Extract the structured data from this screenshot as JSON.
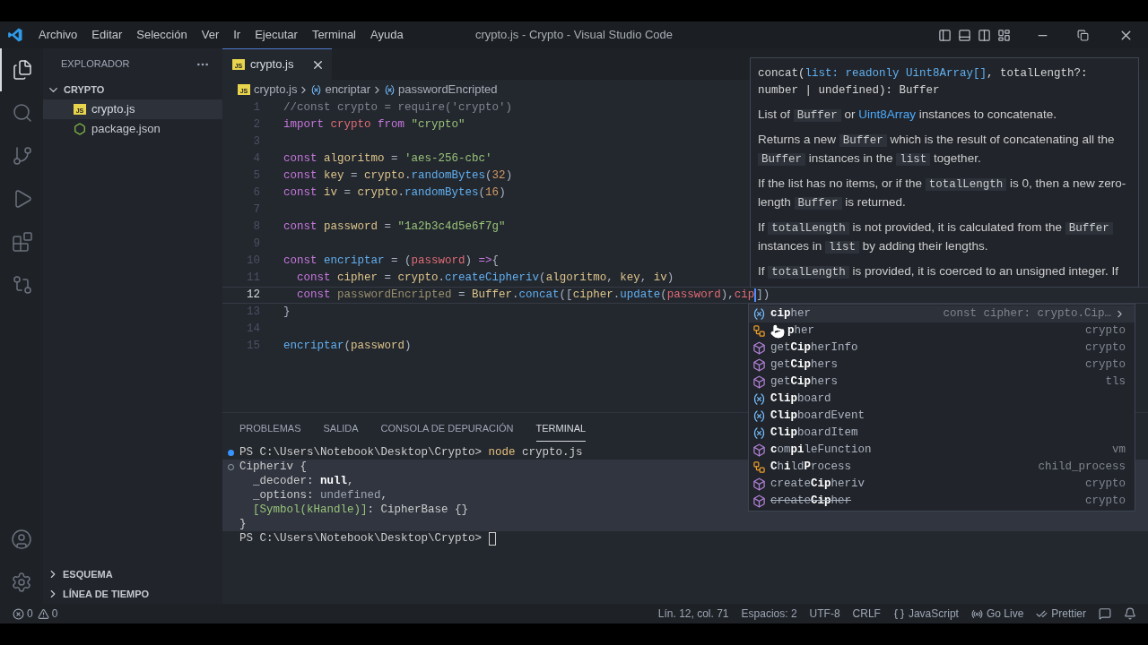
{
  "title_bar": {
    "menu": [
      "Archivo",
      "Editar",
      "Selección",
      "Ver",
      "Ir",
      "Ejecutar",
      "Terminal",
      "Ayuda"
    ],
    "title": "crypto.js - Crypto - Visual Studio Code"
  },
  "activity_bar": {
    "top": [
      {
        "kind": "files",
        "selected": true
      },
      {
        "kind": "search",
        "selected": false
      },
      {
        "kind": "source_control",
        "selected": false
      },
      {
        "kind": "run",
        "selected": false
      },
      {
        "kind": "extensions",
        "selected": false
      },
      {
        "kind": "remote",
        "selected": false
      }
    ],
    "bottom": [
      {
        "kind": "account"
      },
      {
        "kind": "settings"
      }
    ]
  },
  "sidebar": {
    "title": "EXPLORADOR",
    "folder": {
      "name": "CRYPTO",
      "expanded": true,
      "files": [
        {
          "name": "crypto.js",
          "kind": "js",
          "icon_text": "JS",
          "selected": true
        },
        {
          "name": "package.json",
          "kind": "json",
          "selected": false
        }
      ]
    },
    "sections": [
      {
        "name": "ESQUEMA",
        "expanded": false
      },
      {
        "name": "LÍNEA DE TIEMPO",
        "expanded": false
      }
    ]
  },
  "editor": {
    "tab": {
      "name": "crypto.js",
      "icon_text": "JS"
    },
    "breadcrumb": [
      {
        "text": "crypto.js",
        "kind": "file",
        "icon_text": "JS"
      },
      {
        "text": "encriptar",
        "kind": "symbol"
      },
      {
        "text": "passwordEncripted",
        "kind": "symbol"
      }
    ],
    "lines": [
      {
        "number": "1",
        "current": false,
        "tokens": [
          {
            "text": "//const crypto = require('crypto')",
            "kind": "comment"
          }
        ]
      },
      {
        "number": "2",
        "current": false,
        "tokens": [
          {
            "text": "import",
            "kind": "keyword"
          },
          {
            "text": " crypto",
            "kind": "module"
          },
          {
            "text": " from",
            "kind": "keyword"
          },
          {
            "text": " \"crypto\"",
            "kind": "string"
          }
        ]
      },
      {
        "number": "3",
        "current": false
      },
      {
        "number": "4",
        "current": false,
        "tokens": [
          {
            "text": "const",
            "kind": "keyword"
          },
          {
            "text": " algoritmo",
            "kind": "variable"
          },
          {
            "text": " = ",
            "kind": "plain"
          },
          {
            "text": "'aes-256-cbc'",
            "kind": "string"
          }
        ]
      },
      {
        "number": "5",
        "current": false,
        "tokens": [
          {
            "text": "const",
            "kind": "keyword"
          },
          {
            "text": " key",
            "kind": "variable"
          },
          {
            "text": " = ",
            "kind": "plain"
          },
          {
            "text": "crypto",
            "kind": "variable"
          },
          {
            "text": ".",
            "kind": "plain"
          },
          {
            "text": "randomBytes",
            "kind": "function"
          },
          {
            "text": "(",
            "kind": "plain"
          },
          {
            "text": "32",
            "kind": "number"
          },
          {
            "text": ")",
            "kind": "plain"
          }
        ]
      },
      {
        "number": "6",
        "current": false,
        "tokens": [
          {
            "text": "const",
            "kind": "keyword"
          },
          {
            "text": " iv",
            "kind": "variable"
          },
          {
            "text": " = ",
            "kind": "plain"
          },
          {
            "text": "crypto",
            "kind": "variable"
          },
          {
            "text": ".",
            "kind": "plain"
          },
          {
            "text": "randomBytes",
            "kind": "function"
          },
          {
            "text": "(",
            "kind": "plain"
          },
          {
            "text": "16",
            "kind": "number"
          },
          {
            "text": ")",
            "kind": "plain"
          }
        ]
      },
      {
        "number": "7",
        "current": false
      },
      {
        "number": "8",
        "current": false,
        "tokens": [
          {
            "text": "const",
            "kind": "keyword"
          },
          {
            "text": " password",
            "kind": "variable"
          },
          {
            "text": " = ",
            "kind": "plain"
          },
          {
            "text": "\"1a2b3c4d5e6f7g\"",
            "kind": "string"
          }
        ]
      },
      {
        "number": "9",
        "current": false
      },
      {
        "number": "10",
        "current": false,
        "tokens": [
          {
            "text": "const",
            "kind": "keyword"
          },
          {
            "text": " encriptar",
            "kind": "function"
          },
          {
            "text": " = (",
            "kind": "plain"
          },
          {
            "text": "password",
            "kind": "param"
          },
          {
            "text": ") ",
            "kind": "plain"
          },
          {
            "text": "=>",
            "kind": "keyword"
          },
          {
            "text": "{",
            "kind": "plain"
          }
        ]
      },
      {
        "number": "11",
        "current": false,
        "tokens": [
          {
            "text": "  const",
            "kind": "keyword"
          },
          {
            "text": " cipher",
            "kind": "variable"
          },
          {
            "text": " = ",
            "kind": "plain"
          },
          {
            "text": "crypto",
            "kind": "variable"
          },
          {
            "text": ".",
            "kind": "plain"
          },
          {
            "text": "createCipheriv",
            "kind": "function"
          },
          {
            "text": "(",
            "kind": "plain"
          },
          {
            "text": "algoritmo",
            "kind": "variable"
          },
          {
            "text": ", ",
            "kind": "plain"
          },
          {
            "text": "key",
            "kind": "variable"
          },
          {
            "text": ", ",
            "kind": "plain"
          },
          {
            "text": "iv",
            "kind": "variable"
          },
          {
            "text": ")",
            "kind": "plain"
          }
        ]
      },
      {
        "number": "12",
        "current": true,
        "tokens": [
          {
            "text": "  const",
            "kind": "keyword"
          },
          {
            "text": " passwordEncripted",
            "kind": "unused"
          },
          {
            "text": " = ",
            "kind": "plain"
          },
          {
            "text": "Buffer",
            "kind": "variable"
          },
          {
            "text": ".",
            "kind": "plain"
          },
          {
            "text": "concat",
            "kind": "function"
          },
          {
            "text": "([",
            "kind": "plain"
          },
          {
            "text": "cipher",
            "kind": "variable"
          },
          {
            "text": ".",
            "kind": "plain"
          },
          {
            "text": "update",
            "kind": "function"
          },
          {
            "text": "(",
            "kind": "plain"
          },
          {
            "text": "password",
            "kind": "param"
          },
          {
            "text": "),",
            "kind": "plain"
          },
          {
            "text": "cip",
            "kind": "param",
            "caret": true
          },
          {
            "text": "])",
            "kind": "plain"
          }
        ]
      },
      {
        "number": "13",
        "current": false,
        "tokens": [
          {
            "text": "}",
            "kind": "plain"
          }
        ]
      },
      {
        "number": "14",
        "current": false
      },
      {
        "number": "15",
        "current": false,
        "tokens": [
          {
            "text": "encriptar",
            "kind": "function"
          },
          {
            "text": "(",
            "kind": "plain"
          },
          {
            "text": "password",
            "kind": "variable"
          },
          {
            "text": ")",
            "kind": "plain"
          }
        ]
      }
    ],
    "hover": {
      "signature": [
        {
          "text": "concat(",
          "kind": "plain"
        },
        {
          "text": "list: readonly Uint8Array[]",
          "kind": "type"
        },
        {
          "text": ", totalLength?: number | undefined): Buffer",
          "kind": "plain"
        }
      ],
      "paragraphs": [
        [
          {
            "text": "List of ",
            "kind": "text"
          },
          {
            "text": "Buffer",
            "kind": "code"
          },
          {
            "text": " or ",
            "kind": "text"
          },
          {
            "text": "Uint8Array",
            "kind": "link"
          },
          {
            "text": " instances to concatenate.",
            "kind": "text"
          }
        ],
        [
          {
            "text": "Returns a new ",
            "kind": "text"
          },
          {
            "text": "Buffer",
            "kind": "code"
          },
          {
            "text": " which is the result of concatenating all the ",
            "kind": "text"
          },
          {
            "text": "Buffer",
            "kind": "code"
          },
          {
            "text": " instances in the ",
            "kind": "text"
          },
          {
            "text": "list",
            "kind": "code"
          },
          {
            "text": " together.",
            "kind": "text"
          }
        ],
        [
          {
            "text": "If the list has no items, or if the ",
            "kind": "text"
          },
          {
            "text": "totalLength",
            "kind": "code"
          },
          {
            "text": " is 0, then a new zero-length ",
            "kind": "text"
          },
          {
            "text": "Buffer",
            "kind": "code"
          },
          {
            "text": " is returned.",
            "kind": "text"
          }
        ],
        [
          {
            "text": "If ",
            "kind": "text"
          },
          {
            "text": "totalLength",
            "kind": "code"
          },
          {
            "text": " is not provided, it is calculated from the ",
            "kind": "text"
          },
          {
            "text": "Buffer",
            "kind": "code"
          },
          {
            "text": " instances in ",
            "kind": "text"
          },
          {
            "text": "list",
            "kind": "code"
          },
          {
            "text": " by adding their lengths.",
            "kind": "text"
          }
        ],
        [
          {
            "text": "If ",
            "kind": "text"
          },
          {
            "text": "totalLength",
            "kind": "code"
          },
          {
            "text": " is provided, it is coerced to an unsigned integer. If",
            "kind": "text"
          }
        ]
      ]
    },
    "suggestions": [
      {
        "kind": "variable",
        "label": "**cip**her",
        "detail": "const cipher: crypto.Cip…",
        "selected": true,
        "deprecated": false
      },
      {
        "kind": "class",
        "label": "**p**her",
        "detail": "crypto",
        "selected": false,
        "deprecated": false,
        "under_pointer": true
      },
      {
        "kind": "method",
        "label": "get**Cip**herInfo",
        "detail": "crypto",
        "selected": false,
        "deprecated": false
      },
      {
        "kind": "method",
        "label": "get**Cip**hers",
        "detail": "crypto",
        "selected": false,
        "deprecated": false
      },
      {
        "kind": "method",
        "label": "get**Cip**hers",
        "detail": "tls",
        "selected": false,
        "deprecated": false
      },
      {
        "kind": "variable",
        "label": "**Clip**board",
        "selected": false,
        "deprecated": false
      },
      {
        "kind": "variable",
        "label": "**Clip**boardEvent",
        "selected": false,
        "deprecated": false
      },
      {
        "kind": "variable",
        "label": "**Clip**boardItem",
        "selected": false,
        "deprecated": false
      },
      {
        "kind": "method",
        "label": "**c**om**pi**leFunction",
        "detail": "vm",
        "selected": false,
        "deprecated": false
      },
      {
        "kind": "class",
        "label": "**C**h**i**ld**P**rocess",
        "detail": "child_process",
        "selected": false,
        "deprecated": false
      },
      {
        "kind": "method",
        "label": "create**Cip**heriv",
        "detail": "crypto",
        "selected": false,
        "deprecated": false
      },
      {
        "kind": "method",
        "label": "create**Cip**her",
        "detail": "crypto",
        "selected": false,
        "deprecated": true
      }
    ]
  },
  "panel": {
    "tabs": [
      {
        "label": "PROBLEMAS",
        "selected": false
      },
      {
        "label": "SALIDA",
        "selected": false
      },
      {
        "label": "CONSOLA DE DEPURACIÓN",
        "selected": false
      },
      {
        "label": "TERMINAL",
        "selected": true
      }
    ],
    "terminal": [
      {
        "kind": "command",
        "highlighted": false,
        "tokens": [
          {
            "text": "PS C:\\Users\\Notebook\\Desktop\\Crypto> ",
            "kind": "plain"
          },
          {
            "text": "node",
            "kind": "command"
          },
          {
            "text": " crypto.js",
            "kind": "plain"
          }
        ]
      },
      {
        "kind": "output",
        "highlighted": true,
        "tokens": [
          {
            "text": "Cipheriv {",
            "kind": "plain"
          }
        ]
      },
      {
        "highlighted": true,
        "tokens": [
          {
            "text": "  _decoder: ",
            "kind": "plain"
          },
          {
            "text": "null",
            "kind": "bold"
          },
          {
            "text": ",",
            "kind": "plain"
          }
        ]
      },
      {
        "highlighted": true,
        "tokens": [
          {
            "text": "  _options: ",
            "kind": "plain"
          },
          {
            "text": "undefined",
            "kind": "muted"
          },
          {
            "text": ",",
            "kind": "plain"
          }
        ]
      },
      {
        "highlighted": true,
        "tokens": [
          {
            "text": "  [Symbol(kHandle)]",
            "kind": "green"
          },
          {
            "text": ": CipherBase {}",
            "kind": "plain"
          }
        ]
      },
      {
        "highlighted": true,
        "tokens": [
          {
            "text": "}",
            "kind": "plain"
          }
        ]
      },
      {
        "highlighted": false,
        "prompt_cursor": true,
        "tokens": [
          {
            "text": "PS C:\\Users\\Notebook\\Desktop\\Crypto> ",
            "kind": "plain"
          }
        ]
      }
    ]
  },
  "status_bar": {
    "errors": "0",
    "warnings": "0",
    "items": [
      {
        "kind": "text",
        "text": "Lín. 12, col. 71"
      },
      {
        "kind": "text",
        "text": "Espacios: 2"
      },
      {
        "kind": "text",
        "text": "UTF-8"
      },
      {
        "kind": "text",
        "text": "CRLF"
      },
      {
        "kind": "language",
        "text": "JavaScript"
      },
      {
        "kind": "golive",
        "text": "Go Live"
      },
      {
        "kind": "prettier",
        "text": "Prettier"
      },
      {
        "kind": "feedback"
      },
      {
        "kind": "bell"
      }
    ]
  }
}
